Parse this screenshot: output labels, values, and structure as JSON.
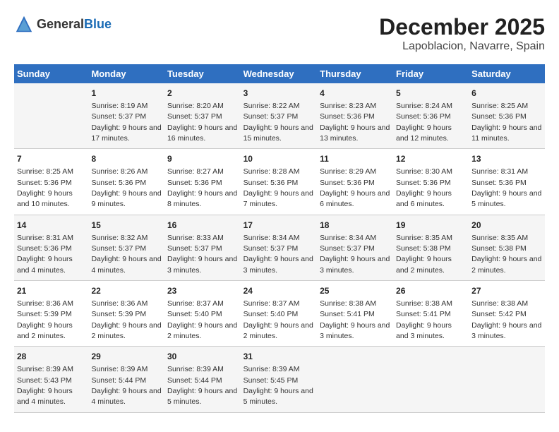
{
  "logo": {
    "text_general": "General",
    "text_blue": "Blue"
  },
  "title": "December 2025",
  "subtitle": "Lapoblacion, Navarre, Spain",
  "headers": [
    "Sunday",
    "Monday",
    "Tuesday",
    "Wednesday",
    "Thursday",
    "Friday",
    "Saturday"
  ],
  "weeks": [
    [
      {
        "day": "",
        "sunrise": "",
        "sunset": "",
        "daylight": ""
      },
      {
        "day": "1",
        "sunrise": "Sunrise: 8:19 AM",
        "sunset": "Sunset: 5:37 PM",
        "daylight": "Daylight: 9 hours and 17 minutes."
      },
      {
        "day": "2",
        "sunrise": "Sunrise: 8:20 AM",
        "sunset": "Sunset: 5:37 PM",
        "daylight": "Daylight: 9 hours and 16 minutes."
      },
      {
        "day": "3",
        "sunrise": "Sunrise: 8:22 AM",
        "sunset": "Sunset: 5:37 PM",
        "daylight": "Daylight: 9 hours and 15 minutes."
      },
      {
        "day": "4",
        "sunrise": "Sunrise: 8:23 AM",
        "sunset": "Sunset: 5:36 PM",
        "daylight": "Daylight: 9 hours and 13 minutes."
      },
      {
        "day": "5",
        "sunrise": "Sunrise: 8:24 AM",
        "sunset": "Sunset: 5:36 PM",
        "daylight": "Daylight: 9 hours and 12 minutes."
      },
      {
        "day": "6",
        "sunrise": "Sunrise: 8:25 AM",
        "sunset": "Sunset: 5:36 PM",
        "daylight": "Daylight: 9 hours and 11 minutes."
      }
    ],
    [
      {
        "day": "7",
        "sunrise": "Sunrise: 8:25 AM",
        "sunset": "Sunset: 5:36 PM",
        "daylight": "Daylight: 9 hours and 10 minutes."
      },
      {
        "day": "8",
        "sunrise": "Sunrise: 8:26 AM",
        "sunset": "Sunset: 5:36 PM",
        "daylight": "Daylight: 9 hours and 9 minutes."
      },
      {
        "day": "9",
        "sunrise": "Sunrise: 8:27 AM",
        "sunset": "Sunset: 5:36 PM",
        "daylight": "Daylight: 9 hours and 8 minutes."
      },
      {
        "day": "10",
        "sunrise": "Sunrise: 8:28 AM",
        "sunset": "Sunset: 5:36 PM",
        "daylight": "Daylight: 9 hours and 7 minutes."
      },
      {
        "day": "11",
        "sunrise": "Sunrise: 8:29 AM",
        "sunset": "Sunset: 5:36 PM",
        "daylight": "Daylight: 9 hours and 6 minutes."
      },
      {
        "day": "12",
        "sunrise": "Sunrise: 8:30 AM",
        "sunset": "Sunset: 5:36 PM",
        "daylight": "Daylight: 9 hours and 6 minutes."
      },
      {
        "day": "13",
        "sunrise": "Sunrise: 8:31 AM",
        "sunset": "Sunset: 5:36 PM",
        "daylight": "Daylight: 9 hours and 5 minutes."
      }
    ],
    [
      {
        "day": "14",
        "sunrise": "Sunrise: 8:31 AM",
        "sunset": "Sunset: 5:36 PM",
        "daylight": "Daylight: 9 hours and 4 minutes."
      },
      {
        "day": "15",
        "sunrise": "Sunrise: 8:32 AM",
        "sunset": "Sunset: 5:37 PM",
        "daylight": "Daylight: 9 hours and 4 minutes."
      },
      {
        "day": "16",
        "sunrise": "Sunrise: 8:33 AM",
        "sunset": "Sunset: 5:37 PM",
        "daylight": "Daylight: 9 hours and 3 minutes."
      },
      {
        "day": "17",
        "sunrise": "Sunrise: 8:34 AM",
        "sunset": "Sunset: 5:37 PM",
        "daylight": "Daylight: 9 hours and 3 minutes."
      },
      {
        "day": "18",
        "sunrise": "Sunrise: 8:34 AM",
        "sunset": "Sunset: 5:37 PM",
        "daylight": "Daylight: 9 hours and 3 minutes."
      },
      {
        "day": "19",
        "sunrise": "Sunrise: 8:35 AM",
        "sunset": "Sunset: 5:38 PM",
        "daylight": "Daylight: 9 hours and 2 minutes."
      },
      {
        "day": "20",
        "sunrise": "Sunrise: 8:35 AM",
        "sunset": "Sunset: 5:38 PM",
        "daylight": "Daylight: 9 hours and 2 minutes."
      }
    ],
    [
      {
        "day": "21",
        "sunrise": "Sunrise: 8:36 AM",
        "sunset": "Sunset: 5:39 PM",
        "daylight": "Daylight: 9 hours and 2 minutes."
      },
      {
        "day": "22",
        "sunrise": "Sunrise: 8:36 AM",
        "sunset": "Sunset: 5:39 PM",
        "daylight": "Daylight: 9 hours and 2 minutes."
      },
      {
        "day": "23",
        "sunrise": "Sunrise: 8:37 AM",
        "sunset": "Sunset: 5:40 PM",
        "daylight": "Daylight: 9 hours and 2 minutes."
      },
      {
        "day": "24",
        "sunrise": "Sunrise: 8:37 AM",
        "sunset": "Sunset: 5:40 PM",
        "daylight": "Daylight: 9 hours and 2 minutes."
      },
      {
        "day": "25",
        "sunrise": "Sunrise: 8:38 AM",
        "sunset": "Sunset: 5:41 PM",
        "daylight": "Daylight: 9 hours and 3 minutes."
      },
      {
        "day": "26",
        "sunrise": "Sunrise: 8:38 AM",
        "sunset": "Sunset: 5:41 PM",
        "daylight": "Daylight: 9 hours and 3 minutes."
      },
      {
        "day": "27",
        "sunrise": "Sunrise: 8:38 AM",
        "sunset": "Sunset: 5:42 PM",
        "daylight": "Daylight: 9 hours and 3 minutes."
      }
    ],
    [
      {
        "day": "28",
        "sunrise": "Sunrise: 8:39 AM",
        "sunset": "Sunset: 5:43 PM",
        "daylight": "Daylight: 9 hours and 4 minutes."
      },
      {
        "day": "29",
        "sunrise": "Sunrise: 8:39 AM",
        "sunset": "Sunset: 5:44 PM",
        "daylight": "Daylight: 9 hours and 4 minutes."
      },
      {
        "day": "30",
        "sunrise": "Sunrise: 8:39 AM",
        "sunset": "Sunset: 5:44 PM",
        "daylight": "Daylight: 9 hours and 5 minutes."
      },
      {
        "day": "31",
        "sunrise": "Sunrise: 8:39 AM",
        "sunset": "Sunset: 5:45 PM",
        "daylight": "Daylight: 9 hours and 5 minutes."
      },
      {
        "day": "",
        "sunrise": "",
        "sunset": "",
        "daylight": ""
      },
      {
        "day": "",
        "sunrise": "",
        "sunset": "",
        "daylight": ""
      },
      {
        "day": "",
        "sunrise": "",
        "sunset": "",
        "daylight": ""
      }
    ]
  ]
}
